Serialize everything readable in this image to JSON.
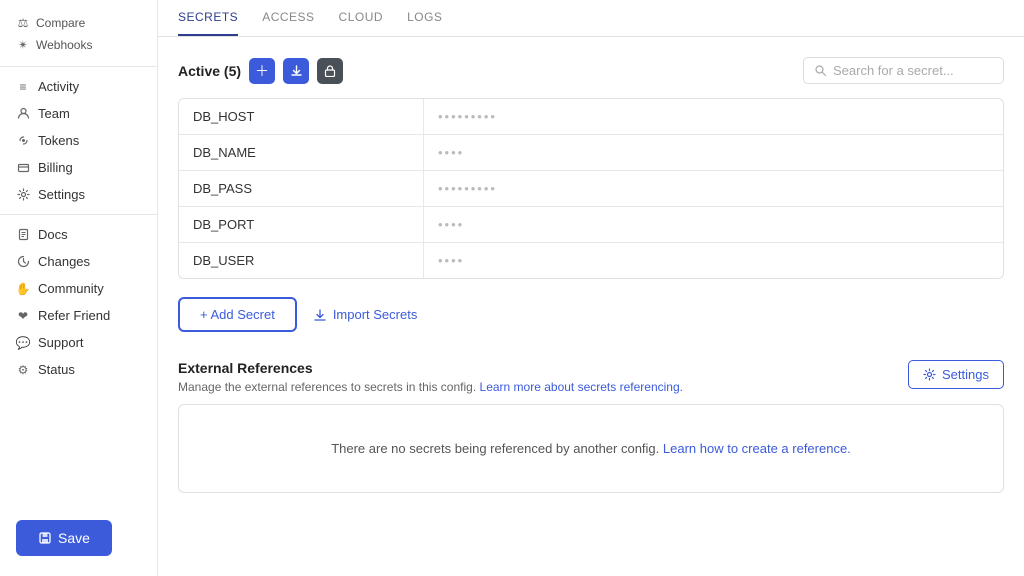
{
  "sidebar": {
    "top_items": [
      {
        "id": "compare",
        "label": "Compare",
        "icon": "⚖"
      },
      {
        "id": "webhooks",
        "label": "Webhooks",
        "icon": "✴"
      }
    ],
    "nav_items": [
      {
        "id": "activity",
        "label": "Activity",
        "icon": "≡"
      },
      {
        "id": "team",
        "label": "Team",
        "icon": "👤"
      },
      {
        "id": "tokens",
        "label": "Tokens",
        "icon": "🔑"
      },
      {
        "id": "billing",
        "label": "Billing",
        "icon": "⚙"
      },
      {
        "id": "settings",
        "label": "Settings",
        "icon": "⚙"
      }
    ],
    "secondary_items": [
      {
        "id": "docs",
        "label": "Docs",
        "icon": "📄"
      },
      {
        "id": "changes",
        "label": "Changes",
        "icon": "🔔"
      },
      {
        "id": "community",
        "label": "Community",
        "icon": "✋"
      },
      {
        "id": "refer-friend",
        "label": "Refer Friend",
        "icon": "❤"
      },
      {
        "id": "support",
        "label": "Support",
        "icon": "💬"
      },
      {
        "id": "status",
        "label": "Status",
        "icon": "⚙"
      }
    ]
  },
  "tabs": [
    {
      "id": "secrets",
      "label": "SECRETS",
      "active": true
    },
    {
      "id": "access",
      "label": "ACCESS",
      "active": false
    },
    {
      "id": "cloud",
      "label": "CLOUD",
      "active": false
    },
    {
      "id": "logs",
      "label": "LOGS",
      "active": false
    }
  ],
  "secrets_section": {
    "title": "Active (5)",
    "search_placeholder": "Search for a secret...",
    "add_btn_label": "+ Add Secret",
    "import_btn_label": "Import Secrets",
    "secrets": [
      {
        "key": "DB_HOST",
        "value": "•••••••••"
      },
      {
        "key": "DB_NAME",
        "value": "••••"
      },
      {
        "key": "DB_PASS",
        "value": "•••••••••"
      },
      {
        "key": "DB_PORT",
        "value": "••••"
      },
      {
        "key": "DB_USER",
        "value": "••••"
      }
    ]
  },
  "external_references": {
    "title": "External References",
    "description": "Manage the external references to secrets in this config.",
    "learn_more_text": "Learn more about secrets referencing.",
    "learn_more_url": "#",
    "settings_btn_label": "Settings",
    "empty_message": "There are no secrets being referenced by another config.",
    "empty_link_text": "Learn how to create a reference.",
    "empty_link_url": "#"
  },
  "save_btn_label": "Save"
}
